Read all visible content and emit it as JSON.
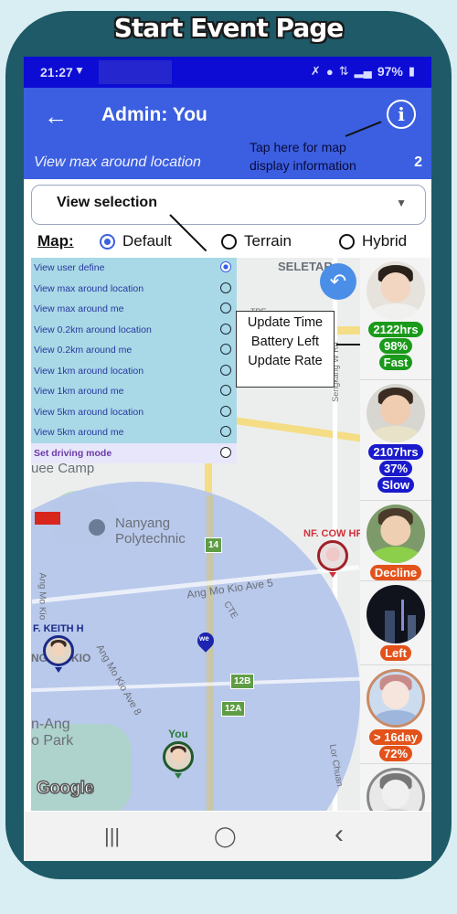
{
  "page_title": "Start Event Page",
  "status_bar": {
    "time": "21:27",
    "notification_icon": "wifi-antenna-icon",
    "right_icons": [
      "mute-icon",
      "location-pin-icon",
      "data-icon",
      "signal-icon"
    ],
    "battery": "97%"
  },
  "app_bar": {
    "back_icon": "back-arrow-icon",
    "title": "Admin: You",
    "info_icon": "info-icon",
    "info_glyph": "i",
    "subtitle": "View max around location",
    "count": "2",
    "hint_line1": "Tap here for map",
    "hint_line2": "display information"
  },
  "view_select": {
    "label": "View selection",
    "caret": "▼"
  },
  "map_type": {
    "label": "Map:",
    "options": [
      {
        "label": "Default",
        "selected": true
      },
      {
        "label": "Terrain",
        "selected": false
      },
      {
        "label": "Hybrid",
        "selected": false
      }
    ]
  },
  "view_options": [
    {
      "label": "View user define",
      "selected": true
    },
    {
      "label": "View max around location",
      "selected": false
    },
    {
      "label": "View max around me",
      "selected": false
    },
    {
      "label": "View 0.2km around location",
      "selected": false
    },
    {
      "label": "View 0.2km around me",
      "selected": false
    },
    {
      "label": "View 1km around location",
      "selected": false
    },
    {
      "label": "View 1km around me",
      "selected": false
    },
    {
      "label": "View 5km around location",
      "selected": false
    },
    {
      "label": "View 5km around me",
      "selected": false
    },
    {
      "label": "Set driving mode",
      "selected": false
    }
  ],
  "callout": {
    "line1": "Update Time",
    "line2": "Battery Left",
    "line3": "Update Rate"
  },
  "map": {
    "labels": {
      "seletar": "SELETAR",
      "tpe": "TPE",
      "seletar_rd": "Sengkang W Rd",
      "camp": "uee Camp",
      "nanyang": "Nanyang",
      "polytechnic": "Polytechnic",
      "ave5": "Ang Mo Kio Ave 5",
      "ang_mo_kio": "NG MO KIO",
      "ave8": "Ang Mo Kio Ave 8",
      "park1": "n-Ang",
      "park2": "o Park",
      "cte": "CTE",
      "lor": "Lor Chuan",
      "amk_ave_vert": "Ang Mo Kio"
    },
    "shields": [
      "14",
      "12B",
      "12A"
    ],
    "markers": [
      {
        "name": "NF. COW HP",
        "color": "#d0303a"
      },
      {
        "name": "F. KEITH H",
        "color": "#1a2a8a"
      },
      {
        "name": "You",
        "color": "#2a7a3a"
      }
    ],
    "we_pin": "we",
    "attribution": "Google"
  },
  "members": [
    {
      "badges": [
        {
          "text": "2122hrs",
          "color": "#1a9a1a"
        },
        {
          "text": "98%",
          "color": "#1a9a1a"
        },
        {
          "text": "Fast",
          "color": "#1a9a1a"
        }
      ]
    },
    {
      "badges": [
        {
          "text": "2107hrs",
          "color": "#1a1acc"
        },
        {
          "text": "37%",
          "color": "#1a1acc"
        },
        {
          "text": "Slow",
          "color": "#1a1acc"
        }
      ]
    },
    {
      "badges": [
        {
          "text": "Decline",
          "color": "#e2521a"
        }
      ]
    },
    {
      "badges": [
        {
          "text": "Left",
          "color": "#e2521a"
        }
      ]
    },
    {
      "badges": [
        {
          "text": "> 16day",
          "color": "#e2521a"
        },
        {
          "text": "72%",
          "color": "#e2521a"
        }
      ]
    },
    {
      "badges": []
    }
  ],
  "nav_bar": {
    "recents": "|||",
    "home": "◯",
    "back": "‹"
  }
}
